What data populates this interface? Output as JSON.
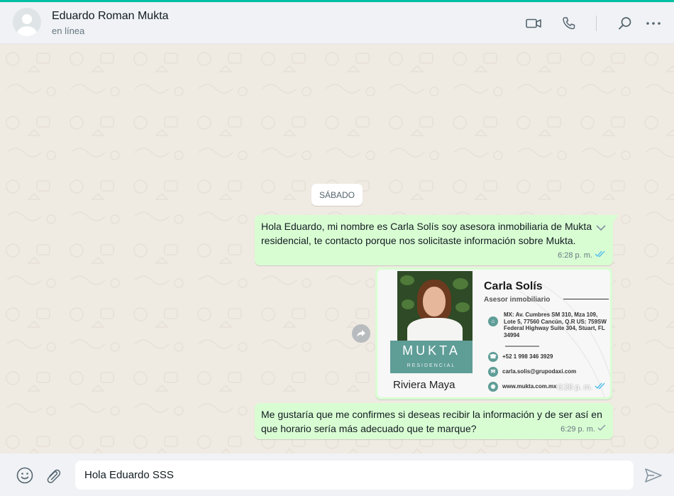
{
  "header": {
    "contact_name": "Eduardo Roman Mukta",
    "status": "en línea",
    "icons": [
      "video-call-icon",
      "voice-call-icon",
      "search-icon",
      "menu-icon"
    ]
  },
  "chat": {
    "day_label": "SÁBADO",
    "messages": [
      {
        "type": "text",
        "text": "Hola Eduardo, mi nombre es Carla Solís soy asesora inmobiliaria de Mukta residencial, te contacto porque nos solicitaste información sobre Mukta.",
        "time": "6:28 p. m.",
        "status": "read"
      },
      {
        "type": "image",
        "time": "6:28 p. m.",
        "status": "read",
        "card": {
          "brand": "MUKTA",
          "brand_sub": "RESIDENCIAL",
          "location": "Riviera Maya",
          "name": "Carla Solís",
          "role": "Asesor inmobiliario",
          "address": "MX: Av. Cumbres SM 310, Mza 109, Lote 5, 77560 Cancún, Q.R US: 759SW Federal Highway Suite 304, Stuart, FL 34994",
          "phone": "+52 1 998 346 3929",
          "email": "carla.solis@grupodaxi.com",
          "web": "www.mukta.com.mx"
        }
      },
      {
        "type": "text",
        "text": "Me gustaría que me confirmes si deseas recibir la información y de ser así en que horario sería más adecuado que te marque?",
        "time": "6:29 p. m.",
        "status": "sent"
      }
    ]
  },
  "composer": {
    "value": "Hola Eduardo SSS"
  },
  "colors": {
    "accent": "#00bfa5",
    "outgoing_bubble": "#d9fdd3",
    "chat_bg": "#efeae2",
    "read_tick": "#53bdeb",
    "card_teal": "#5f9d97"
  }
}
